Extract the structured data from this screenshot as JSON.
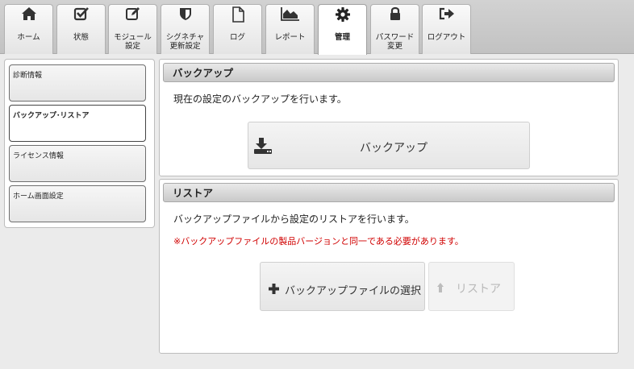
{
  "nav": {
    "tabs": [
      {
        "label": "ホーム",
        "icon": "home-icon"
      },
      {
        "label": "状態",
        "icon": "checkbox-icon"
      },
      {
        "label": "モジュール\n設定",
        "icon": "edit-icon"
      },
      {
        "label": "シグネチャ\n更新設定",
        "icon": "shield-icon"
      },
      {
        "label": "ログ",
        "icon": "document-icon"
      },
      {
        "label": "レポート",
        "icon": "area-chart-icon"
      },
      {
        "label": "管理",
        "icon": "gear-icon"
      },
      {
        "label": "パスワード\n変更",
        "icon": "lock-icon"
      },
      {
        "label": "ログアウト",
        "icon": "sign-out-icon"
      }
    ],
    "active_tab": "管理"
  },
  "sidebar": {
    "items": [
      {
        "label": "診断情報"
      },
      {
        "label": "バックアップ･リストア"
      },
      {
        "label": "ライセンス情報"
      },
      {
        "label": "ホーム画面設定"
      }
    ],
    "active_item": "バックアップ･リストア"
  },
  "backup": {
    "title": "バックアップ",
    "description": "現在の設定のバックアップを行います。",
    "button_label": "バックアップ",
    "button_icon": "download-icon"
  },
  "restore": {
    "title": "リストア",
    "description": "バックアップファイルから設定のリストアを行います。",
    "warning": "※バックアップファイルの製品バージョンと同一である必要があります。",
    "select_button_label": "バックアップファイルの選択",
    "select_button_icon": "plus-icon",
    "restore_button_label": "リストア",
    "restore_button_icon": "upload-icon",
    "restore_button_enabled": false
  },
  "colors": {
    "warning": "#d00000",
    "disabled_text": "#b9b9b9"
  }
}
